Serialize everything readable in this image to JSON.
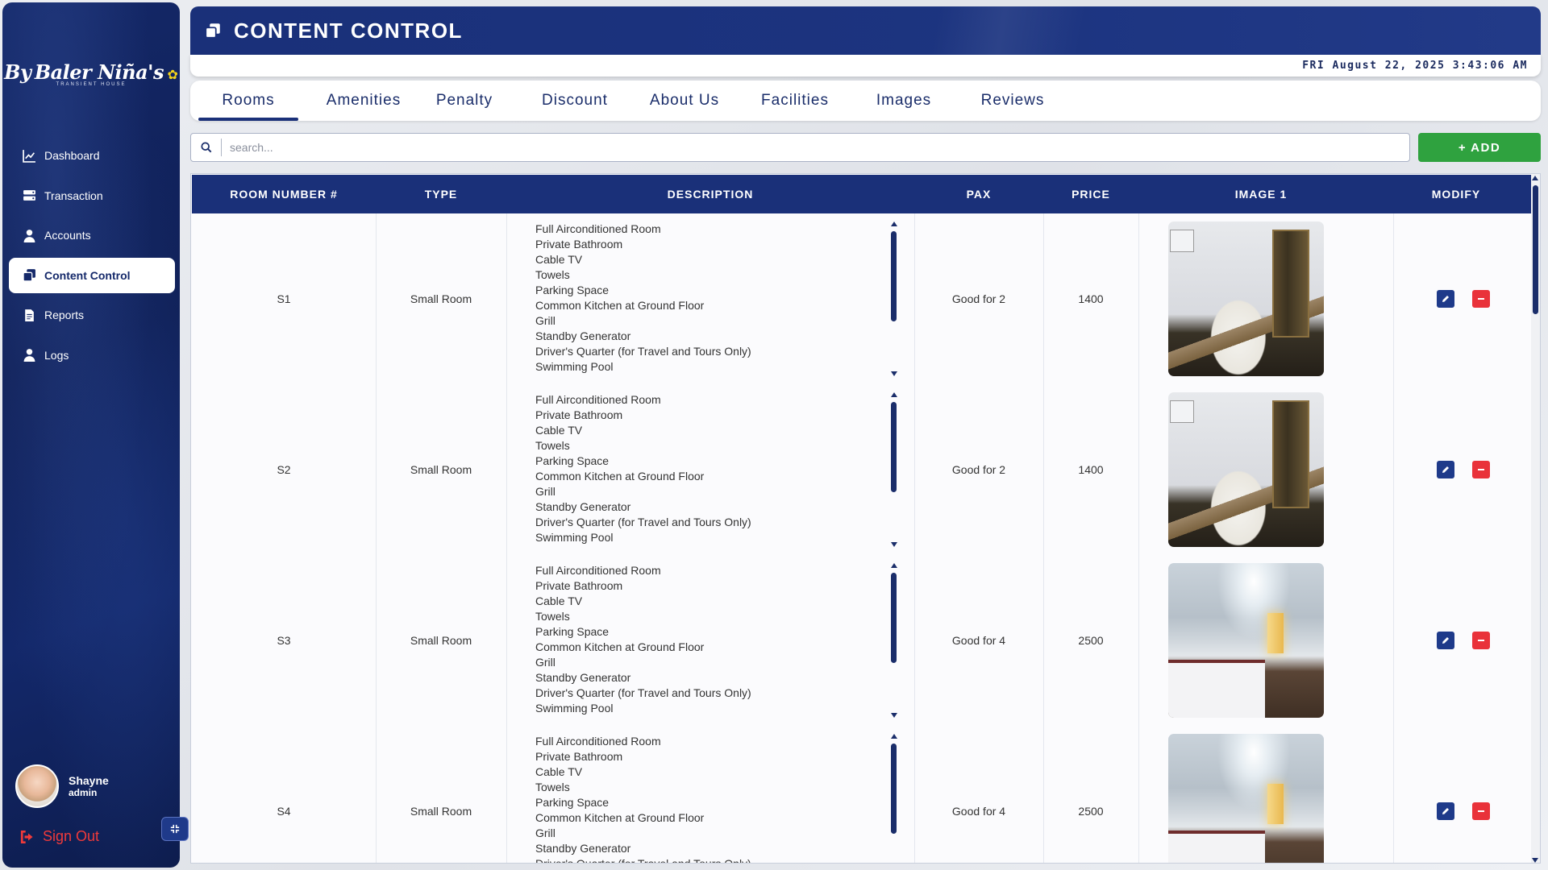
{
  "brand": {
    "logo_text": "Baler Niña's",
    "logo_prefix": "By",
    "logo_sub": "TRANSIENT HOUSE"
  },
  "sidebar": {
    "items": [
      {
        "label": "Dashboard",
        "icon": "chart-line-icon"
      },
      {
        "label": "Transaction",
        "icon": "server-icon"
      },
      {
        "label": "Accounts",
        "icon": "user-icon"
      },
      {
        "label": "Content Control",
        "icon": "copy-icon",
        "active": true
      },
      {
        "label": "Reports",
        "icon": "file-icon"
      },
      {
        "label": "Logs",
        "icon": "user-icon"
      }
    ],
    "user": {
      "name": "Shayne",
      "role": "admin"
    },
    "signout_label": "Sign Out"
  },
  "header": {
    "title": "CONTENT CONTROL",
    "datetime": "FRI August 22, 2025 3:43:06 AM"
  },
  "tabs": [
    {
      "label": "Rooms",
      "active": true
    },
    {
      "label": "Amenities"
    },
    {
      "label": "Penalty"
    },
    {
      "label": "Discount"
    },
    {
      "label": "About Us"
    },
    {
      "label": "Facilities"
    },
    {
      "label": "Images"
    },
    {
      "label": "Reviews"
    }
  ],
  "search": {
    "placeholder": "search..."
  },
  "add_label": "+ ADD",
  "table": {
    "headers": [
      "ROOM NUMBER #",
      "TYPE",
      "DESCRIPTION",
      "PAX",
      "PRICE",
      "IMAGE 1",
      "MODIFY"
    ],
    "rows": [
      {
        "room": "S1",
        "type": "Small Room",
        "pax": "Good for 2",
        "price": "1400",
        "description": [
          "Full Airconditioned Room",
          "Private Bathroom",
          "Cable TV",
          "Towels",
          "Parking Space",
          "Common Kitchen at Ground Floor",
          "Grill",
          "Standby Generator",
          "Driver's Quarter (for Travel and Tours Only)",
          "Swimming Pool"
        ]
      },
      {
        "room": "S2",
        "type": "Small Room",
        "pax": "Good for 2",
        "price": "1400",
        "description": [
          "Full Airconditioned Room",
          "Private Bathroom",
          "Cable TV",
          "Towels",
          "Parking Space",
          "Common Kitchen at Ground Floor",
          "Grill",
          "Standby Generator",
          "Driver's Quarter (for Travel and Tours Only)",
          "Swimming Pool"
        ]
      },
      {
        "room": "S3",
        "type": "Small Room",
        "pax": "Good for 4",
        "price": "2500",
        "description": [
          "Full Airconditioned Room",
          "Private Bathroom",
          "Cable TV",
          "Towels",
          "Parking Space",
          "Common Kitchen at Ground Floor",
          "Grill",
          "Standby Generator",
          "Driver's Quarter (for Travel and Tours Only)",
          "Swimming Pool"
        ]
      },
      {
        "room": "S4",
        "type": "Small Room",
        "pax": "Good for 4",
        "price": "2500",
        "description": [
          "Full Airconditioned Room",
          "Private Bathroom",
          "Cable TV",
          "Towels",
          "Parking Space",
          "Common Kitchen at Ground Floor",
          "Grill",
          "Standby Generator",
          "Driver's Quarter (for Travel and Tours Only)"
        ]
      }
    ]
  }
}
